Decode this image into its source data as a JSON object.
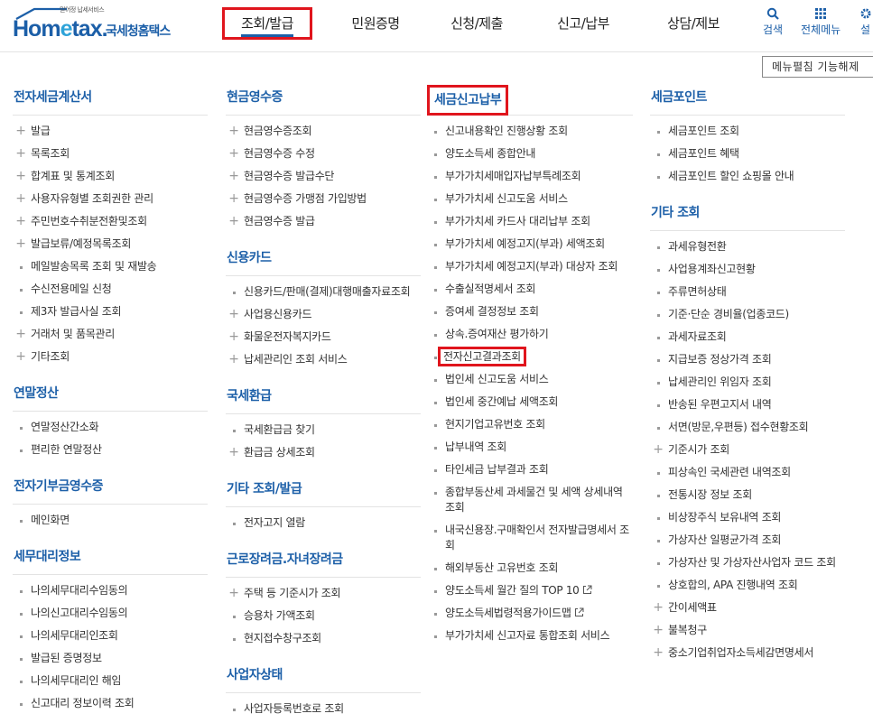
{
  "logo": {
    "tagline": "믿어정 납세서비스",
    "brand_prefix": "Hom",
    "brand_e": "e",
    "brand_suffix": "tax.",
    "korean": "국세청홈택스"
  },
  "gnb": [
    {
      "label": "조회/발급",
      "active": true
    },
    {
      "label": "민원증명"
    },
    {
      "label": "신청/제출"
    },
    {
      "label": "신고/납부"
    },
    {
      "label": "상담/제보"
    }
  ],
  "util": {
    "search": "검색",
    "all_menu": "전체메뉴",
    "settings": "설"
  },
  "menu_toggle": "메뉴펼침 기능해제",
  "col1": {
    "sections": [
      {
        "title": "전자세금계산서",
        "items": [
          {
            "label": "발급",
            "m": "plus"
          },
          {
            "label": "목록조회",
            "m": "plus"
          },
          {
            "label": "합계표 및 통계조회",
            "m": "plus"
          },
          {
            "label": "사용자유형별 조회권한 관리",
            "m": "plus"
          },
          {
            "label": "주민번호수취분전환및조회",
            "m": "plus"
          },
          {
            "label": "발급보류/예정목록조회",
            "m": "plus"
          },
          {
            "label": "메일발송목록 조회 및 재발송",
            "m": "dot"
          },
          {
            "label": "수신전용메일 신청",
            "m": "dot"
          },
          {
            "label": "제3자 발급사실 조회",
            "m": "dot"
          },
          {
            "label": "거래처 및 품목관리",
            "m": "plus"
          },
          {
            "label": "기타조회",
            "m": "plus"
          }
        ]
      },
      {
        "title": "연말정산",
        "items": [
          {
            "label": "연말정산간소화",
            "m": "dot"
          },
          {
            "label": "편리한 연말정산",
            "m": "dot"
          }
        ]
      },
      {
        "title": "전자기부금영수증",
        "items": [
          {
            "label": "메인화면",
            "m": "dot"
          }
        ]
      },
      {
        "title": "세무대리정보",
        "items": [
          {
            "label": "나의세무대리수임동의",
            "m": "dot"
          },
          {
            "label": "나의신고대리수임동의",
            "m": "dot"
          },
          {
            "label": "나의세무대리인조회",
            "m": "dot"
          },
          {
            "label": "발급된 증명정보",
            "m": "dot"
          },
          {
            "label": "나의세무대리인 해임",
            "m": "dot"
          },
          {
            "label": "신고대리 정보이력 조회",
            "m": "dot"
          }
        ]
      }
    ]
  },
  "col2": {
    "sections": [
      {
        "title": "현금영수증",
        "items": [
          {
            "label": "현금영수증조회",
            "m": "plus"
          },
          {
            "label": "현금영수증 수정",
            "m": "plus"
          },
          {
            "label": "현금영수증 발급수단",
            "m": "plus"
          },
          {
            "label": "현금영수증 가맹점 가입방법",
            "m": "plus"
          },
          {
            "label": "현금영수증 발급",
            "m": "plus"
          }
        ]
      },
      {
        "title": "신용카드",
        "items": [
          {
            "label": "신용카드/판매(결제)대행매출자료조회",
            "m": "dot"
          },
          {
            "label": "사업용신용카드",
            "m": "plus"
          },
          {
            "label": "화물운전자복지카드",
            "m": "plus"
          },
          {
            "label": "납세관리인 조회 서비스",
            "m": "plus"
          }
        ]
      },
      {
        "title": "국세환급",
        "items": [
          {
            "label": "국세환급금 찾기",
            "m": "dot"
          },
          {
            "label": "환급금 상세조회",
            "m": "plus"
          }
        ]
      },
      {
        "title": "기타 조회/발급",
        "items": [
          {
            "label": "전자고지 열람",
            "m": "dot"
          }
        ]
      },
      {
        "title": "근로장려금.자녀장려금",
        "items": [
          {
            "label": "주택 등 기준시가 조회",
            "m": "plus"
          },
          {
            "label": "승용차 가액조회",
            "m": "dot"
          },
          {
            "label": "현지접수창구조회",
            "m": "dot"
          }
        ]
      },
      {
        "title": "사업자상태",
        "items": [
          {
            "label": "사업자등록번호로 조회",
            "m": "dot"
          }
        ]
      }
    ]
  },
  "col3": {
    "sections": [
      {
        "title": "세금신고납부",
        "boxed": true,
        "items": [
          {
            "label": "신고내용확인 진행상황 조회",
            "m": "dot"
          },
          {
            "label": "양도소득세 종합안내",
            "m": "dot"
          },
          {
            "label": "부가가치세매입자납부특례조회",
            "m": "dot"
          },
          {
            "label": "부가가치세 신고도움 서비스",
            "m": "dot"
          },
          {
            "label": "부가가치세 카드사 대리납부 조회",
            "m": "dot"
          },
          {
            "label": "부가가치세 예정고지(부과) 세액조회",
            "m": "dot"
          },
          {
            "label": "부가가치세 예정고지(부과) 대상자 조회",
            "m": "dot"
          },
          {
            "label": "수출실적명세서 조회",
            "m": "dot"
          },
          {
            "label": "증여세 결정정보 조회",
            "m": "dot"
          },
          {
            "label": "상속.증여재산 평가하기",
            "m": "dot"
          },
          {
            "label": "전자신고결과조회",
            "m": "dot",
            "boxed": true
          },
          {
            "label": "법인세 신고도움 서비스",
            "m": "dot"
          },
          {
            "label": "법인세 중간예납 세액조회",
            "m": "dot"
          },
          {
            "label": "현지기업고유번호 조회",
            "m": "dot"
          },
          {
            "label": "납부내역 조회",
            "m": "dot"
          },
          {
            "label": "타인세금 납부결과 조회",
            "m": "dot"
          },
          {
            "label": "종합부동산세 과세물건 및 세액 상세내역 조회",
            "m": "dot"
          },
          {
            "label": "내국신용장.구매확인서 전자발급명세서 조회",
            "m": "dot"
          },
          {
            "label": "해외부동산 고유번호 조회",
            "m": "dot"
          },
          {
            "label": "양도소득세 월간 질의 TOP 10",
            "m": "dot",
            "ext": true
          },
          {
            "label": "양도소득세법령적용가이드맵",
            "m": "dot",
            "ext": true
          },
          {
            "label": "부가가치세 신고자료 통합조회 서비스",
            "m": "dot"
          }
        ]
      }
    ]
  },
  "col4": {
    "sections": [
      {
        "title": "세금포인트",
        "items": [
          {
            "label": "세금포인트 조회",
            "m": "dot"
          },
          {
            "label": "세금포인트 혜택",
            "m": "dot"
          },
          {
            "label": "세금포인트 할인 쇼핑몰 안내",
            "m": "dot"
          }
        ]
      },
      {
        "title": "기타 조회",
        "items": [
          {
            "label": "과세유형전환",
            "m": "dot"
          },
          {
            "label": "사업용계좌신고현황",
            "m": "dot"
          },
          {
            "label": "주류면허상태",
            "m": "dot"
          },
          {
            "label": "기준·단순 경비율(업종코드)",
            "m": "dot"
          },
          {
            "label": "과세자료조회",
            "m": "dot"
          },
          {
            "label": "지급보증 정상가격 조회",
            "m": "dot"
          },
          {
            "label": "납세관리인 위임자 조회",
            "m": "dot"
          },
          {
            "label": "반송된 우편고지서 내역",
            "m": "dot"
          },
          {
            "label": "서면(방문,우편등) 접수현황조회",
            "m": "dot"
          },
          {
            "label": "기준시가 조회",
            "m": "plus"
          },
          {
            "label": "피상속인 국세관련 내역조회",
            "m": "dot"
          },
          {
            "label": "전통시장 정보 조회",
            "m": "dot"
          },
          {
            "label": "비상장주식 보유내역 조회",
            "m": "dot"
          },
          {
            "label": "가상자산 일평균가격 조회",
            "m": "dot"
          },
          {
            "label": "가상자산 및 가상자산사업자 코드 조회",
            "m": "dot"
          },
          {
            "label": "상호합의, APA 진행내역 조회",
            "m": "dot"
          },
          {
            "label": "간이세액표",
            "m": "plus"
          },
          {
            "label": "불복청구",
            "m": "plus"
          },
          {
            "label": "중소기업취업자소득세감면명세서",
            "m": "plus"
          }
        ]
      }
    ]
  }
}
